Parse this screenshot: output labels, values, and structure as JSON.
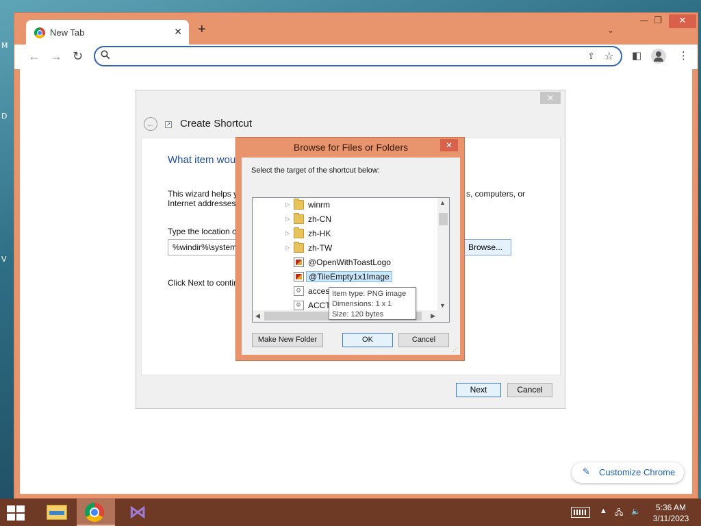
{
  "desktop": {
    "side_letters": [
      "M",
      "D",
      "V"
    ]
  },
  "browser": {
    "tab": {
      "title": "New Tab"
    },
    "new_tab_symbol": "+",
    "tab_search_symbol": "⌄",
    "window_buttons": {
      "minimize": "—",
      "maximize": "❐",
      "close": "✕"
    },
    "omnibox": {
      "value": "",
      "placeholder": ""
    },
    "customize_label": "Customize Chrome"
  },
  "wizard": {
    "title": "Create Shortcut",
    "heading": "What item wou",
    "desc_line1": "This wizard helps yo",
    "desc_line2": "Internet addresses.",
    "desc_right": "s, computers, or",
    "location_label": "Type the location o",
    "location_value": "%windir%\\system",
    "browse_label": "Browse...",
    "next_hint": "Click Next to contin",
    "next_button": "Next",
    "cancel_button": "Cancel"
  },
  "browse_dialog": {
    "title": "Browse for Files or Folders",
    "prompt": "Select the target of the shortcut below:",
    "items": [
      {
        "name": "winrm",
        "type": "folder",
        "expandable": true
      },
      {
        "name": "zh-CN",
        "type": "folder",
        "expandable": true
      },
      {
        "name": "zh-HK",
        "type": "folder",
        "expandable": true
      },
      {
        "name": "zh-TW",
        "type": "folder",
        "expandable": true
      },
      {
        "name": "@OpenWithToastLogo",
        "type": "png",
        "expandable": false
      },
      {
        "name": "@TileEmpty1x1Image",
        "type": "png",
        "expandable": false,
        "selected": true
      },
      {
        "name": "acces",
        "type": "file",
        "expandable": false
      },
      {
        "name": "ACCT",
        "type": "file",
        "expandable": false
      }
    ],
    "tooltip": {
      "line1": "Item type: PNG image",
      "line2": "Dimensions: 1 x 1",
      "line3": "Size: 120 bytes"
    },
    "make_new_folder": "Make New Folder",
    "ok": "OK",
    "cancel": "Cancel"
  },
  "taskbar": {
    "apps": [
      "file-explorer",
      "chrome",
      "visual-studio"
    ],
    "clock_time": "5:36 AM",
    "clock_date": "3/11/2023"
  },
  "colors": {
    "window_frame": "#e8956e",
    "close_red": "#d9604a",
    "taskbar": "#6e3a26",
    "link_blue": "#1a5fb4"
  }
}
